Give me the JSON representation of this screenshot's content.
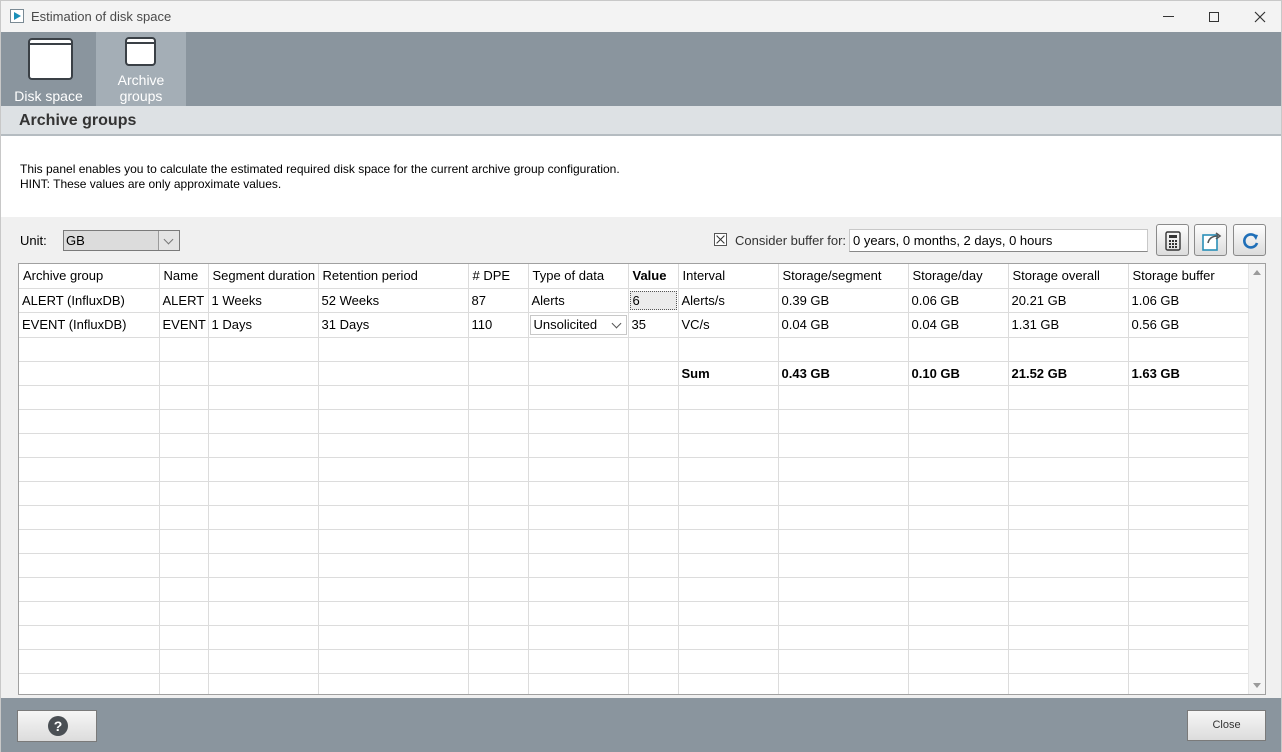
{
  "window": {
    "title": "Estimation of disk space",
    "app_icon": "panel-app-icon",
    "controls": [
      "minimize-icon",
      "maximize-icon",
      "close-icon"
    ]
  },
  "toolbar": {
    "buttons": [
      {
        "label": "Disk space",
        "icon": "window-icon",
        "active": false
      },
      {
        "label_line1": "Archive",
        "label_line2": "groups",
        "icon": "window-icon",
        "active": true
      }
    ]
  },
  "section": {
    "title": "Archive groups",
    "description_line1": "This panel enables you to calculate the estimated required disk space for the current archive group configuration.",
    "description_line2": "HINT: These values are only approximate values."
  },
  "settings": {
    "unit_label": "Unit:",
    "unit_value": "GB",
    "buffer_checked": true,
    "buffer_label": "Consider buffer for:",
    "buffer_value": "0 years, 0 months, 2 days, 0 hours",
    "action_icons": [
      "calculator-icon",
      "export-icon",
      "refresh-icon"
    ]
  },
  "table": {
    "headers": [
      "Archive group",
      "Name",
      "Segment duration",
      "Retention period",
      "# DPE",
      "Type of data",
      "Value",
      "Interval",
      "Storage/segment",
      "Storage/day",
      "Storage overall",
      "Storage buffer"
    ],
    "rows": [
      [
        "ALERT (InfluxDB)",
        "ALERT",
        "1 Weeks",
        "52 Weeks",
        "87",
        "Alerts",
        "6",
        "Alerts/s",
        "0.39 GB",
        "0.06 GB",
        "20.21 GB",
        "1.06 GB"
      ],
      [
        "EVENT (InfluxDB)",
        "EVENT",
        "1 Days",
        "31 Days",
        "110",
        "Unsolicited",
        "35",
        "VC/s",
        "0.04 GB",
        "0.04 GB",
        "1.31 GB",
        "0.56 GB"
      ]
    ],
    "sum": {
      "label": "Sum",
      "storage_segment": "0.43 GB",
      "storage_day": "0.10 GB",
      "storage_overall": "21.52 GB",
      "storage_buffer": "1.63 GB"
    }
  },
  "footer": {
    "help_icon": "help-icon",
    "help_symbol": "?",
    "close_label": "Close"
  },
  "colors": {
    "toolbar_bg": "#8a959e",
    "toolbar_active_bg": "#a4aeb6",
    "section_bg": "#dde1e4",
    "settings_bg": "#f0f0f0"
  }
}
